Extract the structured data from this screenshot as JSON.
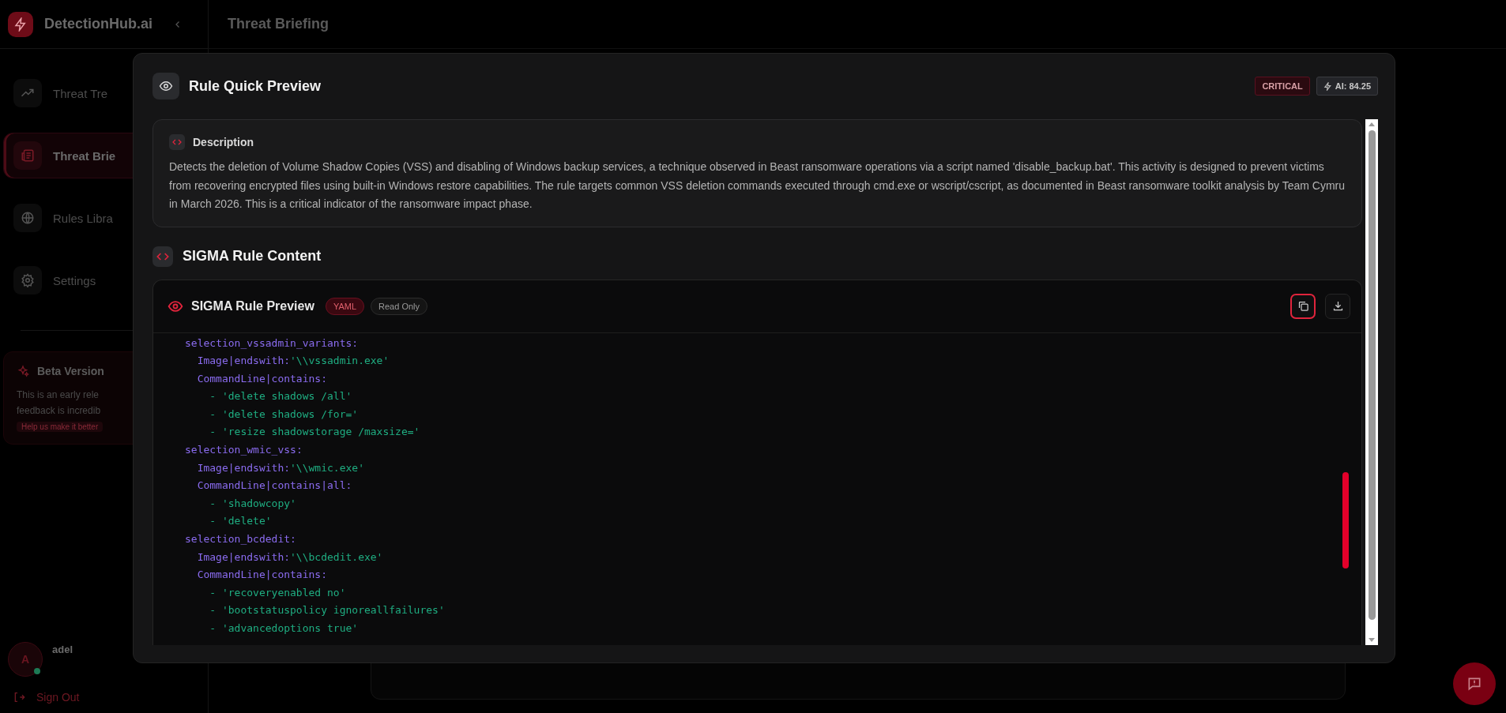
{
  "app": {
    "name": "DetectionHub.ai"
  },
  "sidebar": {
    "items": [
      {
        "label": "Threat Tre",
        "kind": "trend",
        "selected": false
      },
      {
        "label": "Threat Brie",
        "kind": "news",
        "selected": true
      },
      {
        "label": "Rules Libra",
        "kind": "globe",
        "selected": false
      },
      {
        "label": "Settings",
        "kind": "gear",
        "selected": false
      }
    ],
    "beta": {
      "title": "Beta Version",
      "lines": [
        "This is an early rele",
        "feedback is incredib"
      ],
      "link": "Help us make it better"
    },
    "user": {
      "initial": "A",
      "name": "adel",
      "online": true
    },
    "sign_out": "Sign Out"
  },
  "header": {
    "title": "Threat Briefing"
  },
  "modal": {
    "title": "Rule Quick Preview",
    "severity": "CRITICAL",
    "ai_score": "AI: 84.25",
    "description": {
      "heading": "Description",
      "text": "Detects the deletion of Volume Shadow Copies (VSS) and disabling of Windows backup services, a technique observed in Beast ransomware operations via a script named 'disable_backup.bat'. This activity is designed to prevent victims from recovering encrypted files using built-in Windows restore capabilities. The rule targets common VSS deletion commands executed through cmd.exe or wscript/cscript, as documented in Beast ransomware toolkit analysis by Team Cymru in March 2026. This is a critical indicator of the ransomware impact phase."
    },
    "section_title": "SIGMA Rule Content",
    "editor": {
      "title": "SIGMA Rule Preview",
      "tags": [
        {
          "label": "YAML",
          "kind": "format"
        },
        {
          "label": "Read Only",
          "kind": "mode"
        }
      ],
      "buttons": [
        {
          "kind": "copy",
          "focused": true
        },
        {
          "kind": "download",
          "focused": false
        }
      ],
      "code": [
        {
          "key": "selection_vssadmin_variants:",
          "children": [
            {
              "key": "Image|endswith:",
              "value": "'\\\\vssadmin.exe'"
            },
            {
              "key": "CommandLine|contains:",
              "children": [
                {
                  "item": "- 'delete shadows /all'"
                },
                {
                  "item": "- 'delete shadows /for='"
                },
                {
                  "item": "- 'resize shadowstorage /maxsize='"
                }
              ]
            }
          ]
        },
        {
          "key": "selection_wmic_vss:",
          "children": [
            {
              "key": "Image|endswith:",
              "value": "'\\\\wmic.exe'"
            },
            {
              "key": "CommandLine|contains|all:",
              "children": [
                {
                  "item": "- 'shadowcopy'"
                },
                {
                  "item": "- 'delete'"
                }
              ]
            }
          ]
        },
        {
          "key": "selection_bcdedit:",
          "children": [
            {
              "key": "Image|endswith:",
              "value": "'\\\\bcdedit.exe'"
            },
            {
              "key": "CommandLine|contains:",
              "children": [
                {
                  "item": "- 'recoveryenabled no'"
                },
                {
                  "item": "- 'bootstatuspolicy ignoreallfailures'"
                },
                {
                  "item": "- 'advancedoptions true'"
                }
              ]
            }
          ]
        }
      ]
    }
  }
}
